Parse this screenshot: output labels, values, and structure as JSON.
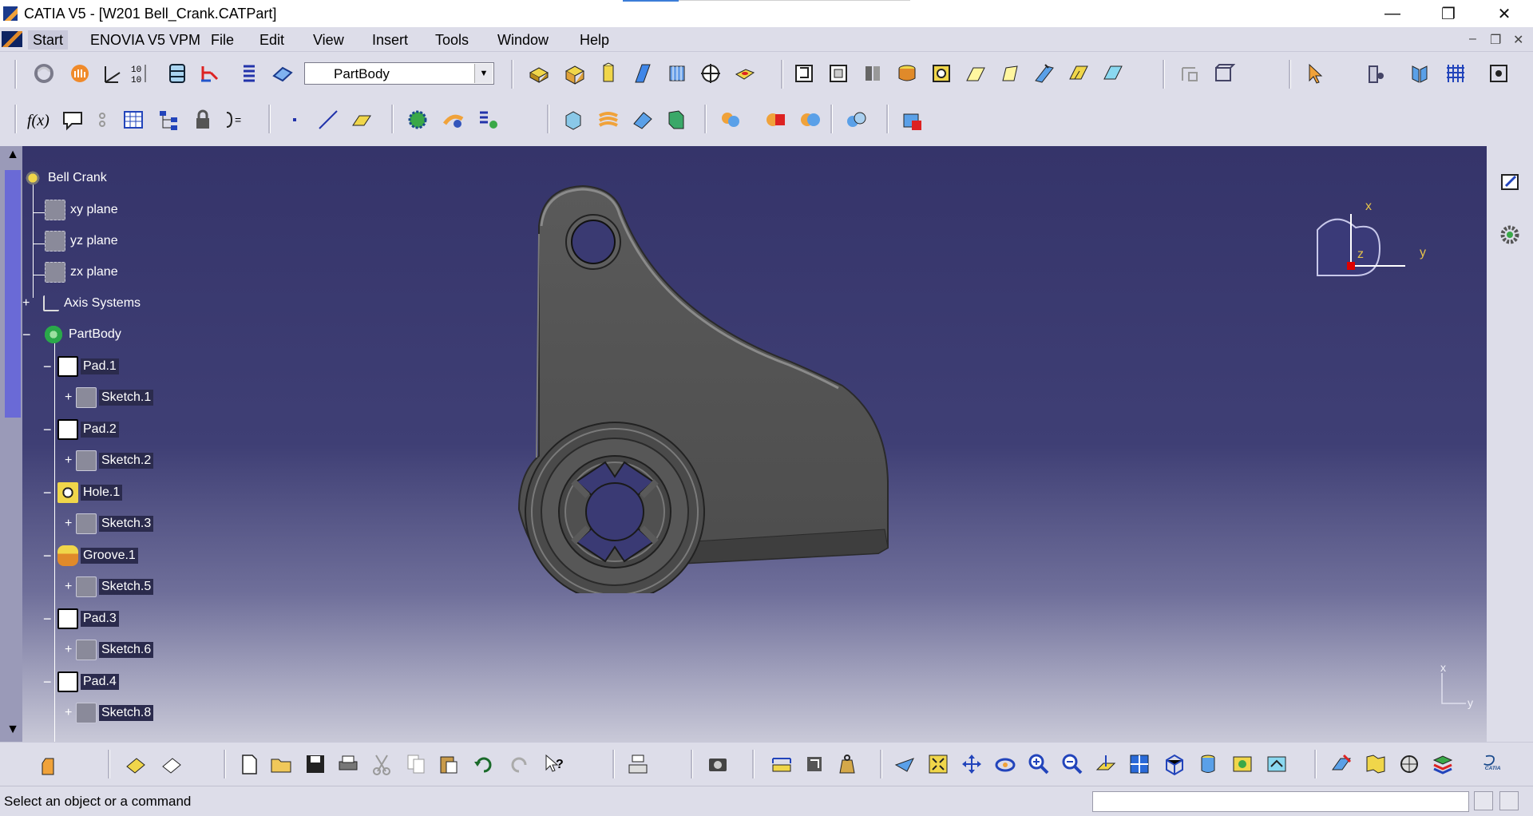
{
  "window": {
    "title": "CATIA V5 - [W201 Bell_Crank.CATPart]",
    "minimize_glyph": "—",
    "restore_glyph": "❐",
    "close_glyph": "✕"
  },
  "menu": {
    "items": [
      "Start",
      "ENOVIA V5 VPM",
      "File",
      "Edit",
      "View",
      "Insert",
      "Tools",
      "Window",
      "Help"
    ],
    "mdi_minimize": "–",
    "mdi_restore": "❐",
    "mdi_close": "✕"
  },
  "toolbar": {
    "workbench_value": "PartBody"
  },
  "tree": {
    "root": "Bell Crank",
    "nodes": [
      {
        "label": "xy plane",
        "icon": "plane-icon"
      },
      {
        "label": "yz plane",
        "icon": "plane-icon"
      },
      {
        "label": "zx plane",
        "icon": "plane-icon"
      },
      {
        "label": "Axis Systems",
        "icon": "axis-system-icon"
      },
      {
        "label": "PartBody",
        "icon": "body-icon"
      },
      {
        "label": "Pad.1",
        "icon": "pad-icon"
      },
      {
        "label": "Sketch.1",
        "icon": "sketch-icon"
      },
      {
        "label": "Pad.2",
        "icon": "pad-icon"
      },
      {
        "label": "Sketch.2",
        "icon": "sketch-icon"
      },
      {
        "label": "Hole.1",
        "icon": "hole-icon"
      },
      {
        "label": "Sketch.3",
        "icon": "sketch-icon"
      },
      {
        "label": "Groove.1",
        "icon": "groove-icon"
      },
      {
        "label": "Sketch.5",
        "icon": "sketch-icon"
      },
      {
        "label": "Pad.3",
        "icon": "pad-icon"
      },
      {
        "label": "Sketch.6",
        "icon": "sketch-icon"
      },
      {
        "label": "Pad.4",
        "icon": "pad-icon"
      },
      {
        "label": "Sketch.8",
        "icon": "sketch-icon"
      }
    ]
  },
  "compass": {
    "x_label": "x",
    "y_label": "y",
    "z_label": "z"
  },
  "mini_axes": {
    "x_label": "x",
    "y_label": "y"
  },
  "status": {
    "message": "Select an object or a command"
  },
  "colors": {
    "chrome": "#dddde9",
    "viewport_top": "#35346a",
    "part_gray": "#565656",
    "compass_accent": "#e6c34a"
  }
}
